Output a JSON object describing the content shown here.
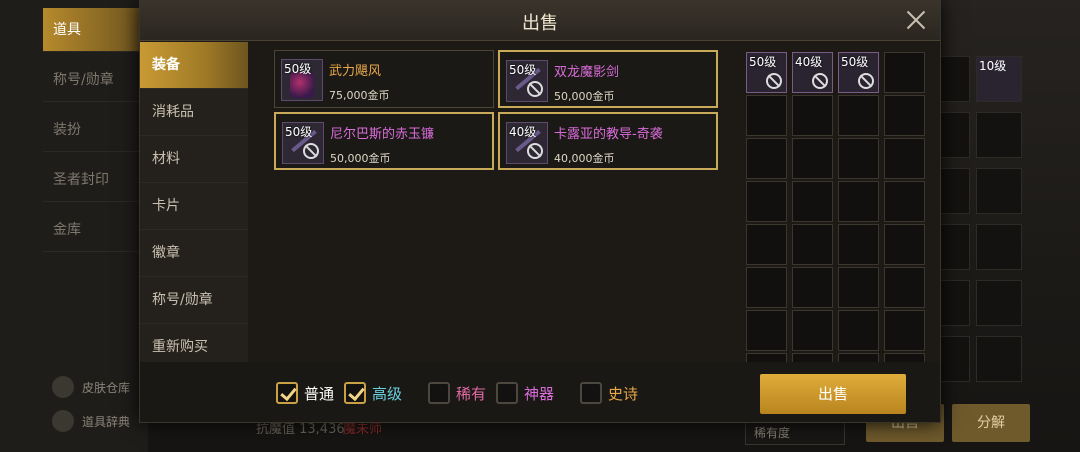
{
  "background": {
    "tabs": [
      "道具",
      "称号/勋章",
      "装扮",
      "圣者封印",
      "金库"
    ],
    "links": [
      "皮肤仓库",
      "道具辞典"
    ],
    "stat_label": "抗魔值 13,436",
    "stat_status": "魔未师",
    "rarity_select": "稀有度",
    "right_slot_labels": [
      "50级",
      "10级"
    ],
    "store_button": "出售",
    "disassemble_button": "分解"
  },
  "modal": {
    "title": "出售",
    "categories": [
      "装备",
      "消耗品",
      "材料",
      "卡片",
      "徽章",
      "称号/勋章",
      "重新购买"
    ],
    "items": [
      {
        "level": "50级",
        "name": "武力飓风",
        "price": "75,000金币",
        "name_color": "orange"
      },
      {
        "level": "50级",
        "name": "双龙魔影剑",
        "price": "50,000金币",
        "name_color": "purple"
      },
      {
        "level": "50级",
        "name": "尼尔巴斯的赤玉镰",
        "price": "50,000金币",
        "name_color": "purple"
      },
      {
        "level": "40级",
        "name": "卡露亚的教导-奇袭",
        "price": "40,000金币",
        "name_color": "purple"
      }
    ],
    "slots": [
      "50级",
      "40级",
      "50级"
    ],
    "filters": [
      {
        "label": "普通",
        "checked": true,
        "color": "#ffffff"
      },
      {
        "label": "高级",
        "checked": true,
        "color": "#6ccfe0"
      },
      {
        "label": "稀有",
        "checked": false,
        "color": "#e06aa2"
      },
      {
        "label": "神器",
        "checked": false,
        "color": "#d86cd9"
      },
      {
        "label": "史诗",
        "checked": false,
        "color": "#e8a84a"
      }
    ],
    "sell_button": "出售"
  }
}
